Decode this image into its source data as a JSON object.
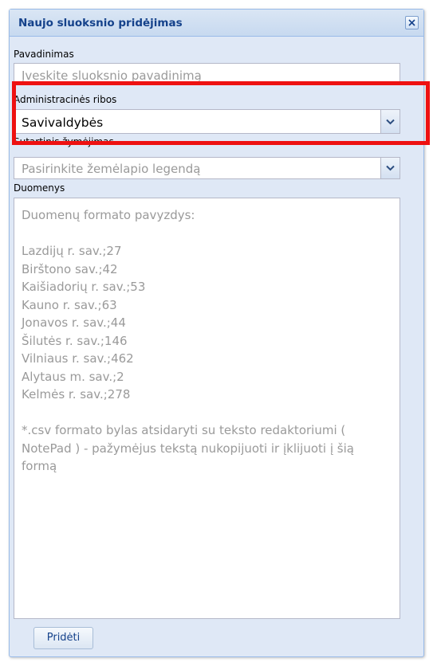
{
  "dialog": {
    "title": "Naujo sluoksnio pridėjimas",
    "close_icon": "close-icon"
  },
  "form": {
    "name": {
      "label": "Pavadinimas",
      "placeholder": "Įveskite sluoksnio pavadinimą"
    },
    "boundaries": {
      "label": "Administracinės ribos",
      "value": "Savivaldybės",
      "trigger_icon": "chevron-down-icon"
    },
    "legend": {
      "label": "Sutartinis žymėjimas",
      "placeholder": "Pasirinkite žemėlapio legendą",
      "trigger_icon": "chevron-down-icon"
    },
    "data": {
      "label": "Duomenys",
      "placeholder": "Duomenų formato pavyzdys:\n\nLazdijų r. sav.;27\nBirštono sav.;42\nKaišiadorių r. sav.;53\nKauno r. sav.;63\nJonavos r. sav.;44\nŠilutės r. sav.;146\nVilniaus r. sav.;462\nAlytaus m. sav.;2\nKelmės r. sav.;278\n\n*.csv formato bylas atsidaryti su teksto redaktoriumi ( NotePad ) - pažymėjus tekstą nukopijuoti ir įklijuoti į šią formą"
    },
    "add_button": "Pridėti"
  },
  "colors": {
    "title": "#15428b",
    "highlight": "#ee1111",
    "panel_bg": "#dfe8f6",
    "placeholder": "#9a9a9a"
  }
}
